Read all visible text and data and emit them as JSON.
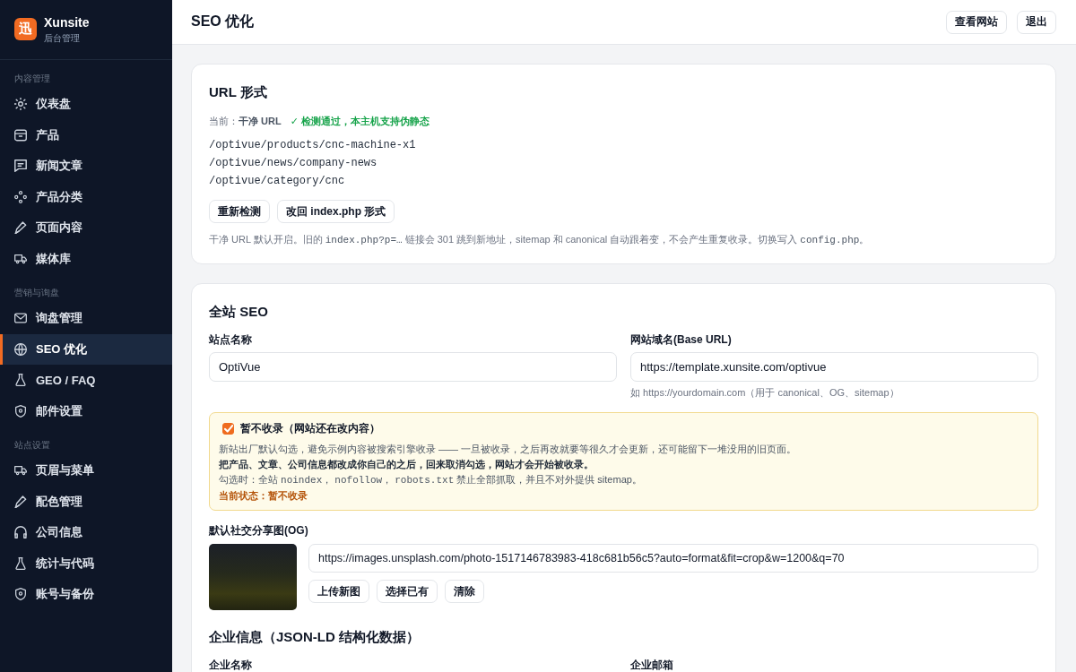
{
  "sidebar": {
    "logo": {
      "glyph": "迅",
      "name": "Xunsite",
      "subtitle": "后台管理"
    },
    "sections": [
      {
        "title": "内容管理",
        "items": [
          {
            "label": "仪表盘",
            "selected": false
          },
          {
            "label": "产品",
            "selected": false
          },
          {
            "label": "新闻文章",
            "selected": false
          },
          {
            "label": "产品分类",
            "selected": false
          },
          {
            "label": "页面内容",
            "selected": false
          },
          {
            "label": "媒体库",
            "selected": false
          }
        ]
      },
      {
        "title": "营销与询盘",
        "items": [
          {
            "label": "询盘管理",
            "selected": false
          },
          {
            "label": "SEO 优化",
            "selected": true
          },
          {
            "label": "GEO / FAQ",
            "selected": false
          },
          {
            "label": "邮件设置",
            "selected": false
          }
        ]
      },
      {
        "title": "站点设置",
        "items": [
          {
            "label": "页眉与菜单",
            "selected": false
          },
          {
            "label": "配色管理",
            "selected": false
          },
          {
            "label": "公司信息",
            "selected": false
          },
          {
            "label": "统计与代码",
            "selected": false
          },
          {
            "label": "账号与备份",
            "selected": false
          }
        ]
      }
    ]
  },
  "header": {
    "title": "SEO 优化",
    "buttons": [
      "查看网站",
      "退出"
    ]
  },
  "url_card": {
    "title": "URL 形式",
    "current": "当前：**干净 URL**",
    "check": "✓ 检测通过，本主机支持伪静态",
    "examples": [
      "/optivue/products/cnc-machine-x1",
      "/optivue/news/company-news",
      "/optivue/category/cnc"
    ],
    "buttons": [
      "重新检测",
      "改回 index.php 形式"
    ],
    "note": [
      {
        "kind": "text",
        "text": "干净 URL 默认开启。旧的 "
      },
      {
        "kind": "code",
        "text": "index.php?p=…"
      },
      {
        "kind": "text",
        "text": " 链接会 301 跳到新地址，sitemap 和 canonical 自动跟着变，不会产生重复收录。切换写入 "
      },
      {
        "kind": "code",
        "text": "config.php"
      },
      {
        "kind": "text",
        "text": "。"
      }
    ]
  },
  "seo_card": {
    "title": "全站 SEO",
    "fields": [
      {
        "label": "站点名称",
        "value": "OptiVue"
      },
      {
        "label": "网站域名(Base URL)",
        "value": "https://template.xunsite.com/optivue",
        "hint": "如 https://yourdomain.com（用于 canonical、OG、sitemap）"
      }
    ],
    "noindex": {
      "checked": true,
      "label": "暂不收录（网站还在改内容）",
      "lines": [
        {
          "kind": "plain",
          "parts": [
            {
              "kind": "text",
              "text": "新站出厂默认勾选，避免示例内容被搜索引擎收录 —— 一旦被收录，之后再改就要等很久才会更新，还可能留下一堆没用的旧页面。"
            }
          ]
        },
        {
          "kind": "strong",
          "parts": [
            {
              "kind": "text",
              "text": "把产品、文章、公司信息都改成你自己的之后，回来取消勾选，网站才会开始被收录。"
            }
          ]
        },
        {
          "kind": "plain",
          "parts": [
            {
              "kind": "text",
              "text": "勾选时：全站 "
            },
            {
              "kind": "code",
              "text": "noindex"
            },
            {
              "kind": "text",
              "text": "， "
            },
            {
              "kind": "code",
              "text": "nofollow"
            },
            {
              "kind": "text",
              "text": "， "
            },
            {
              "kind": "code",
              "text": "robots.txt"
            },
            {
              "kind": "text",
              "text": " 禁止全部抓取，并且不对外提供 sitemap。"
            }
          ]
        },
        {
          "kind": "status",
          "parts": [
            {
              "kind": "text",
              "text": "当前状态：暂不收录"
            }
          ]
        }
      ]
    },
    "og": {
      "label": "默认社交分享图(OG)",
      "url": "https://images.unsplash.com/photo-1517146783983-418c681b56c5?auto=format&fit=crop&w=1200&q=70",
      "buttons": [
        "上传新图",
        "选择已有",
        "清除"
      ]
    },
    "org": {
      "title": "企业信息（JSON-LD 结构化数据）",
      "labels": [
        "企业名称",
        "企业邮箱"
      ]
    }
  }
}
